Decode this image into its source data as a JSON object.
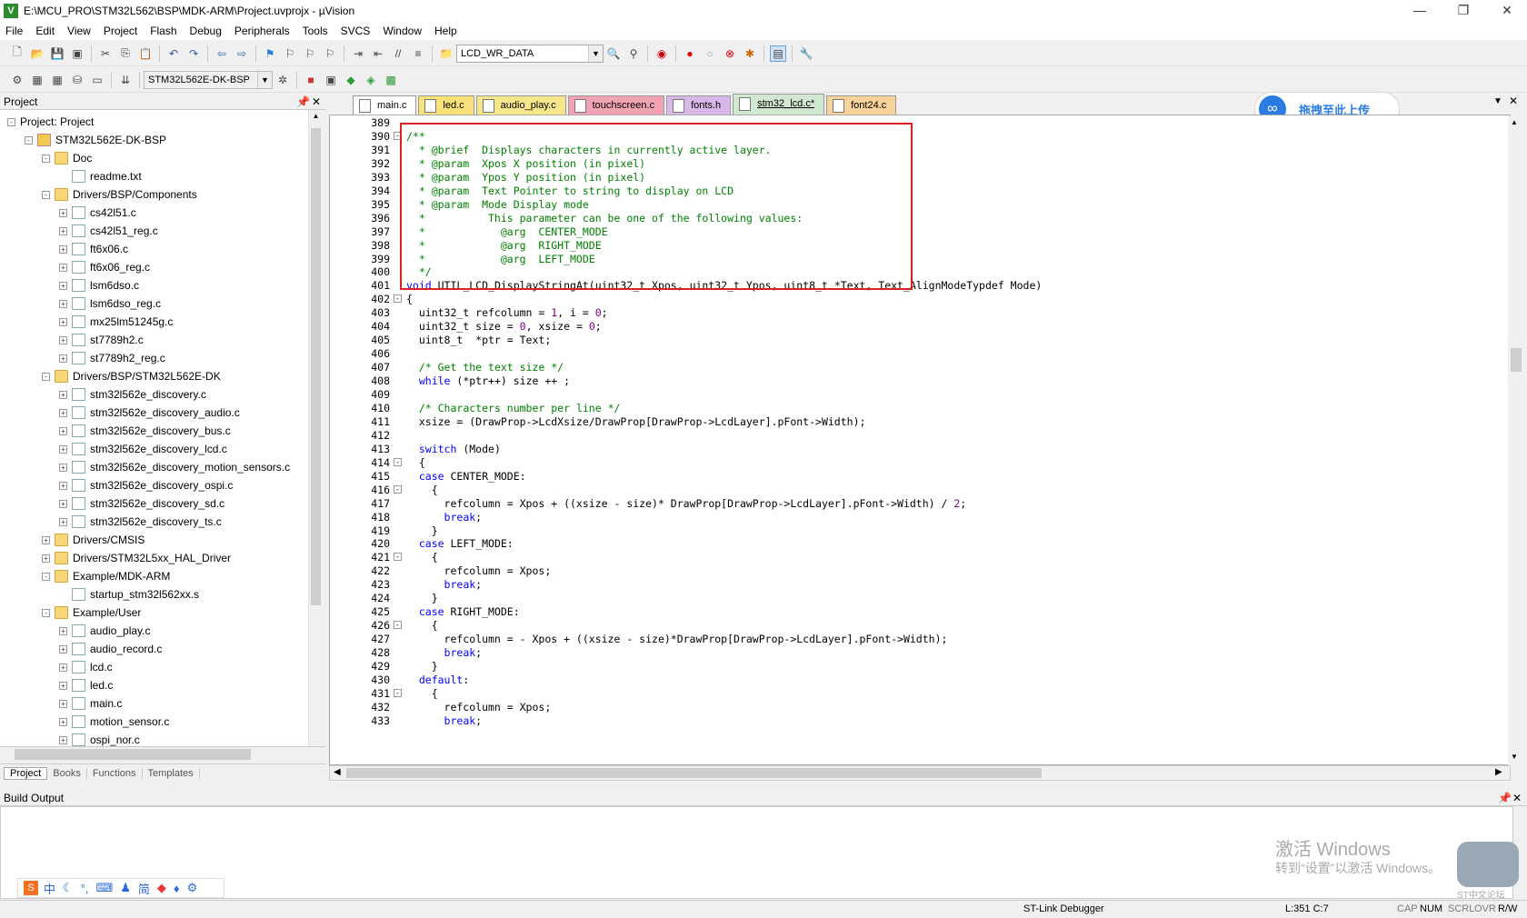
{
  "window": {
    "title": "E:\\MCU_PRO\\STM32L562\\BSP\\MDK-ARM\\Project.uvprojx - µVision",
    "app_icon": "V"
  },
  "menu": [
    "File",
    "Edit",
    "View",
    "Project",
    "Flash",
    "Debug",
    "Peripherals",
    "Tools",
    "SVCS",
    "Window",
    "Help"
  ],
  "toolbar1": {
    "find_combo": "LCD_WR_DATA"
  },
  "toolbar2": {
    "target_combo": "STM32L562E-DK-BSP"
  },
  "project_panel": {
    "title": "Project"
  },
  "tree": [
    {
      "label": "Project: Project",
      "depth": 0,
      "type": "root",
      "exp": "-"
    },
    {
      "label": "STM32L562E-DK-BSP",
      "depth": 1,
      "type": "proj",
      "exp": "-"
    },
    {
      "label": "Doc",
      "depth": 2,
      "type": "folder",
      "exp": "-"
    },
    {
      "label": "readme.txt",
      "depth": 3,
      "type": "file",
      "exp": ""
    },
    {
      "label": "Drivers/BSP/Components",
      "depth": 2,
      "type": "folder",
      "exp": "-"
    },
    {
      "label": "cs42l51.c",
      "depth": 3,
      "type": "file",
      "exp": "+"
    },
    {
      "label": "cs42l51_reg.c",
      "depth": 3,
      "type": "file",
      "exp": "+"
    },
    {
      "label": "ft6x06.c",
      "depth": 3,
      "type": "file",
      "exp": "+"
    },
    {
      "label": "ft6x06_reg.c",
      "depth": 3,
      "type": "file",
      "exp": "+"
    },
    {
      "label": "lsm6dso.c",
      "depth": 3,
      "type": "file",
      "exp": "+"
    },
    {
      "label": "lsm6dso_reg.c",
      "depth": 3,
      "type": "file",
      "exp": "+"
    },
    {
      "label": "mx25lm51245g.c",
      "depth": 3,
      "type": "file",
      "exp": "+"
    },
    {
      "label": "st7789h2.c",
      "depth": 3,
      "type": "file",
      "exp": "+"
    },
    {
      "label": "st7789h2_reg.c",
      "depth": 3,
      "type": "file",
      "exp": "+"
    },
    {
      "label": "Drivers/BSP/STM32L562E-DK",
      "depth": 2,
      "type": "folder",
      "exp": "-"
    },
    {
      "label": "stm32l562e_discovery.c",
      "depth": 3,
      "type": "file",
      "exp": "+"
    },
    {
      "label": "stm32l562e_discovery_audio.c",
      "depth": 3,
      "type": "file",
      "exp": "+"
    },
    {
      "label": "stm32l562e_discovery_bus.c",
      "depth": 3,
      "type": "file",
      "exp": "+"
    },
    {
      "label": "stm32l562e_discovery_lcd.c",
      "depth": 3,
      "type": "file",
      "exp": "+"
    },
    {
      "label": "stm32l562e_discovery_motion_sensors.c",
      "depth": 3,
      "type": "file",
      "exp": "+"
    },
    {
      "label": "stm32l562e_discovery_ospi.c",
      "depth": 3,
      "type": "file",
      "exp": "+"
    },
    {
      "label": "stm32l562e_discovery_sd.c",
      "depth": 3,
      "type": "file",
      "exp": "+"
    },
    {
      "label": "stm32l562e_discovery_ts.c",
      "depth": 3,
      "type": "file",
      "exp": "+"
    },
    {
      "label": "Drivers/CMSIS",
      "depth": 2,
      "type": "folder",
      "exp": "+"
    },
    {
      "label": "Drivers/STM32L5xx_HAL_Driver",
      "depth": 2,
      "type": "folder",
      "exp": "+"
    },
    {
      "label": "Example/MDK-ARM",
      "depth": 2,
      "type": "folder",
      "exp": "-"
    },
    {
      "label": "startup_stm32l562xx.s",
      "depth": 3,
      "type": "file",
      "exp": ""
    },
    {
      "label": "Example/User",
      "depth": 2,
      "type": "folder",
      "exp": "-"
    },
    {
      "label": "audio_play.c",
      "depth": 3,
      "type": "file",
      "exp": "+"
    },
    {
      "label": "audio_record.c",
      "depth": 3,
      "type": "file",
      "exp": "+"
    },
    {
      "label": "lcd.c",
      "depth": 3,
      "type": "file",
      "exp": "+"
    },
    {
      "label": "led.c",
      "depth": 3,
      "type": "file",
      "exp": "+"
    },
    {
      "label": "main.c",
      "depth": 3,
      "type": "file",
      "exp": "+"
    },
    {
      "label": "motion_sensor.c",
      "depth": 3,
      "type": "file",
      "exp": "+"
    },
    {
      "label": "ospi_nor.c",
      "depth": 3,
      "type": "file",
      "exp": "+"
    }
  ],
  "bottom_tabs": [
    "Project",
    "Books",
    "Functions",
    "Templates"
  ],
  "file_tabs": [
    {
      "label": "main.c",
      "color": "#ffffff",
      "active": false
    },
    {
      "label": "led.c",
      "color": "#fbe17a",
      "active": false
    },
    {
      "label": "audio_play.c",
      "color": "#f6e68a",
      "active": false
    },
    {
      "label": "touchscreen.c",
      "color": "#f2a3b3",
      "active": false
    },
    {
      "label": "fonts.h",
      "color": "#d8b8e8",
      "active": false
    },
    {
      "label": "stm32_lcd.c*",
      "color": "#cfe8cf",
      "active": true
    },
    {
      "label": "font24.c",
      "color": "#f7d39a",
      "active": false
    }
  ],
  "upload_badge": "拖拽至此上传",
  "code": [
    {
      "n": "389",
      "f": "",
      "h": ""
    },
    {
      "n": "390",
      "f": "-",
      "h": "<span class='c'>/**</span>"
    },
    {
      "n": "391",
      "f": "",
      "h": "<span class='c'>  * @brief  Displays characters in currently active layer.</span>"
    },
    {
      "n": "392",
      "f": "",
      "h": "<span class='c'>  * @param  Xpos X position (in pixel)</span>"
    },
    {
      "n": "393",
      "f": "",
      "h": "<span class='c'>  * @param  Ypos Y position (in pixel)</span>"
    },
    {
      "n": "394",
      "f": "",
      "h": "<span class='c'>  * @param  Text Pointer to string to display on LCD</span>"
    },
    {
      "n": "395",
      "f": "",
      "h": "<span class='c'>  * @param  Mode Display mode</span>"
    },
    {
      "n": "396",
      "f": "",
      "h": "<span class='c'>  *          This parameter can be one of the following values:</span>"
    },
    {
      "n": "397",
      "f": "",
      "h": "<span class='c'>  *            @arg  CENTER_MODE</span>"
    },
    {
      "n": "398",
      "f": "",
      "h": "<span class='c'>  *            @arg  RIGHT_MODE</span>"
    },
    {
      "n": "399",
      "f": "",
      "h": "<span class='c'>  *            @arg  LEFT_MODE</span>"
    },
    {
      "n": "400",
      "f": "",
      "h": "<span class='c'>  */</span>"
    },
    {
      "n": "401",
      "f": "",
      "h": "<span class='k'>void</span> UTIL_LCD_DisplayStringAt(uint32_t Xpos, uint32_t Ypos, uint8_t *Text, Text_AlignModeTypdef Mode)"
    },
    {
      "n": "402",
      "f": "-",
      "h": "{"
    },
    {
      "n": "403",
      "f": "",
      "h": "  uint32_t refcolumn = <span class='n'>1</span>, i = <span class='n'>0</span>;"
    },
    {
      "n": "404",
      "f": "",
      "h": "  uint32_t size = <span class='n'>0</span>, xsize = <span class='n'>0</span>;"
    },
    {
      "n": "405",
      "f": "",
      "h": "  uint8_t  *ptr = Text;"
    },
    {
      "n": "406",
      "f": "",
      "h": ""
    },
    {
      "n": "407",
      "f": "",
      "h": "  <span class='c'>/* Get the text size */</span>"
    },
    {
      "n": "408",
      "f": "",
      "h": "  <span class='k'>while</span> (*ptr++) size ++ ;"
    },
    {
      "n": "409",
      "f": "",
      "h": ""
    },
    {
      "n": "410",
      "f": "",
      "h": "  <span class='c'>/* Characters number per line */</span>"
    },
    {
      "n": "411",
      "f": "",
      "h": "  xsize = (DrawProp->LcdXsize/DrawProp[DrawProp->LcdLayer].pFont->Width);"
    },
    {
      "n": "412",
      "f": "",
      "h": ""
    },
    {
      "n": "413",
      "f": "",
      "h": "  <span class='k'>switch</span> (Mode)"
    },
    {
      "n": "414",
      "f": "-",
      "h": "  {"
    },
    {
      "n": "415",
      "f": "",
      "h": "  <span class='k'>case</span> CENTER_MODE:"
    },
    {
      "n": "416",
      "f": "-",
      "h": "    {"
    },
    {
      "n": "417",
      "f": "",
      "h": "      refcolumn = Xpos + ((xsize - size)* DrawProp[DrawProp->LcdLayer].pFont->Width) / <span class='n'>2</span>;"
    },
    {
      "n": "418",
      "f": "",
      "h": "      <span class='k'>break</span>;"
    },
    {
      "n": "419",
      "f": "",
      "h": "    }"
    },
    {
      "n": "420",
      "f": "",
      "h": "  <span class='k'>case</span> LEFT_MODE:"
    },
    {
      "n": "421",
      "f": "-",
      "h": "    {"
    },
    {
      "n": "422",
      "f": "",
      "h": "      refcolumn = Xpos;"
    },
    {
      "n": "423",
      "f": "",
      "h": "      <span class='k'>break</span>;"
    },
    {
      "n": "424",
      "f": "",
      "h": "    }"
    },
    {
      "n": "425",
      "f": "",
      "h": "  <span class='k'>case</span> RIGHT_MODE:"
    },
    {
      "n": "426",
      "f": "-",
      "h": "    {"
    },
    {
      "n": "427",
      "f": "",
      "h": "      refcolumn = - Xpos + ((xsize - size)*DrawProp[DrawProp->LcdLayer].pFont->Width);"
    },
    {
      "n": "428",
      "f": "",
      "h": "      <span class='k'>break</span>;"
    },
    {
      "n": "429",
      "f": "",
      "h": "    }"
    },
    {
      "n": "430",
      "f": "",
      "h": "  <span class='k'>default</span>:"
    },
    {
      "n": "431",
      "f": "-",
      "h": "    {"
    },
    {
      "n": "432",
      "f": "",
      "h": "      refcolumn = Xpos;"
    },
    {
      "n": "433",
      "f": "",
      "h": "      <span class='k'>break</span>;"
    }
  ],
  "build_output": {
    "title": "Build Output"
  },
  "watermark": {
    "line1": "激活 Windows",
    "line2": "转到“设置”以激活 Windows。",
    "logo_text": "ST中文论坛"
  },
  "ime_bar": [
    "中",
    "简"
  ],
  "status": {
    "debugger": "ST-Link Debugger",
    "position": "L:351 C:7",
    "caps": "CAP",
    "num": "NUM",
    "scrl": "SCRL",
    "ovr": "OVR",
    "rw": "R/W"
  }
}
